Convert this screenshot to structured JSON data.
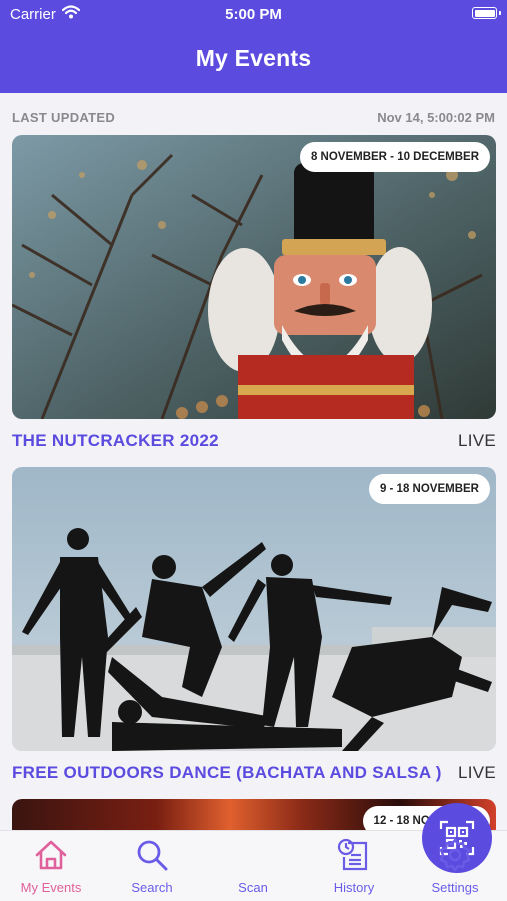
{
  "status_bar": {
    "carrier": "Carrier",
    "time": "5:00 PM"
  },
  "header": {
    "title": "My Events"
  },
  "last_updated": {
    "label": "LAST UPDATED",
    "value": "Nov 14, 5:00:02 PM"
  },
  "events": [
    {
      "title": "THE NUTCRACKER 2022",
      "dates": "8 NOVEMBER - 10 DECEMBER",
      "status": "LIVE"
    },
    {
      "title": "FREE OUTDOORS DANCE (BACHATA AND SALSA )",
      "dates": "9 - 18 NOVEMBER",
      "status": "LIVE"
    },
    {
      "title": "",
      "dates": "12 - 18 NOVEMBER",
      "status": ""
    }
  ],
  "tabs": {
    "my_events": "My Events",
    "search": "Search",
    "scan": "Scan",
    "history": "History",
    "settings": "Settings"
  },
  "colors": {
    "brand": "#5b4bdf",
    "active_tab": "#e0609c"
  },
  "icons": [
    "wifi-icon",
    "battery-icon",
    "home-icon",
    "search-icon",
    "qr-code-icon",
    "history-icon",
    "gear-icon"
  ]
}
